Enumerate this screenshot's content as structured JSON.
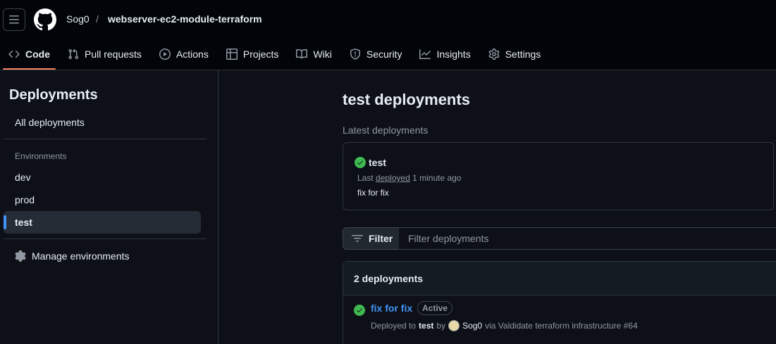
{
  "header": {
    "owner": "Sog0",
    "separator": "/",
    "repo": "webserver-ec2-module-terraform"
  },
  "tabs": [
    {
      "label": "Code",
      "icon": "code-icon"
    },
    {
      "label": "Pull requests",
      "icon": "git-pull-request-icon"
    },
    {
      "label": "Actions",
      "icon": "play-icon"
    },
    {
      "label": "Projects",
      "icon": "table-icon"
    },
    {
      "label": "Wiki",
      "icon": "book-icon"
    },
    {
      "label": "Security",
      "icon": "shield-icon"
    },
    {
      "label": "Insights",
      "icon": "graph-icon"
    },
    {
      "label": "Settings",
      "icon": "gear-icon"
    }
  ],
  "sidebar": {
    "title": "Deployments",
    "all_label": "All deployments",
    "environments_heading": "Environments",
    "environments": [
      "dev",
      "prod",
      "test"
    ],
    "selected": "test",
    "manage_label": "Manage environments"
  },
  "main": {
    "title": "test deployments",
    "latest_label": "Latest deployments",
    "latest": {
      "env": "test",
      "meta_prefix": "Last",
      "meta_link": "deployed",
      "meta_time": "1 minute ago",
      "message": "fix for fix"
    },
    "filter": {
      "button_label": "Filter",
      "placeholder": "Filter deployments"
    },
    "list": {
      "count_label": "2 deployments",
      "rows": [
        {
          "title": "fix for fix",
          "badge": "Active",
          "deployed_to_prefix": "Deployed to",
          "env": "test",
          "by": "by",
          "user": "Sog0",
          "via": "via Valdidate terraform infrastructure #64"
        }
      ]
    }
  },
  "colors": {
    "background": "#0d1117",
    "header_bg": "#010409",
    "accent_blue": "#4493f8",
    "success_green": "#3fb950",
    "active_tab_underline": "#f78166"
  }
}
